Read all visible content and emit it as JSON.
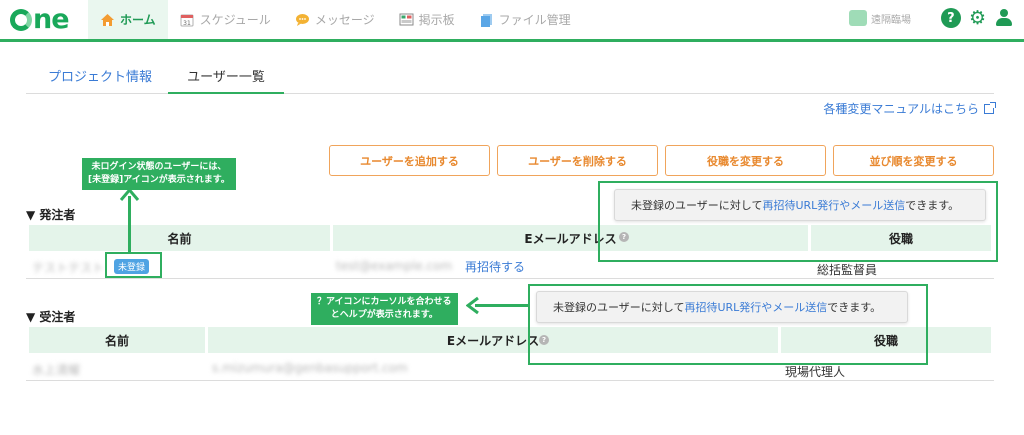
{
  "header": {
    "logo": "One",
    "nav": [
      {
        "label": "ホーム",
        "icon": "home-icon",
        "active": true
      },
      {
        "label": "スケジュール",
        "icon": "calendar-icon",
        "active": false
      },
      {
        "label": "メッセージ",
        "icon": "message-icon",
        "active": false
      },
      {
        "label": "掲示板",
        "icon": "board-icon",
        "active": false
      },
      {
        "label": "ファイル管理",
        "icon": "file-icon",
        "active": false
      }
    ],
    "meeting_label": "遠隔臨場",
    "help_glyph": "?",
    "gear_glyph": "⚙"
  },
  "tabs": [
    {
      "label": "プロジェクト情報",
      "active": false
    },
    {
      "label": "ユーザー一覧",
      "active": true
    }
  ],
  "manual_link": "各種変更マニュアルはこちら",
  "actions": {
    "add_user": "ユーザーを追加する",
    "delete_user": "ユーザーを削除する",
    "change_role": "役職を変更する",
    "reorder": "並び順を変更する"
  },
  "sections": {
    "orderer": {
      "title": "▼ 発注者",
      "headers": {
        "name": "名前",
        "email": "Eメールアドレス",
        "role": "役職"
      },
      "rows": [
        {
          "name": "テストテスト",
          "badge": "未登録",
          "email": "test@example.com",
          "reinvite": "再招待する",
          "role": "総括監督員"
        }
      ]
    },
    "contractor": {
      "title": "▼ 受注者",
      "headers": {
        "name": "名前",
        "email": "Eメールアドレス",
        "role": "役職"
      },
      "rows": [
        {
          "name": "水上清耀",
          "email": "s.mizumura@genbasupport.com",
          "role": "現場代理人"
        }
      ]
    }
  },
  "tooltip": {
    "prefix": "未登録のユーザーに対して",
    "highlight": "再招待URL発行やメール送信",
    "suffix": "できます。"
  },
  "annotations": {
    "unregistered_line1": "未ログイン状態のユーザーには、",
    "unregistered_line2": "[未登録]アイコンが表示されます。",
    "help_line1": "？アイコンにカーソルを合わせる",
    "help_line2": "とヘルプが表示されます。"
  },
  "colors": {
    "brand_green": "#2fae5f",
    "link_blue": "#3a7bd5",
    "button_orange": "#e8892f",
    "header_cell_bg": "#e4f4ea",
    "badge_blue": "#4fa3e3"
  }
}
